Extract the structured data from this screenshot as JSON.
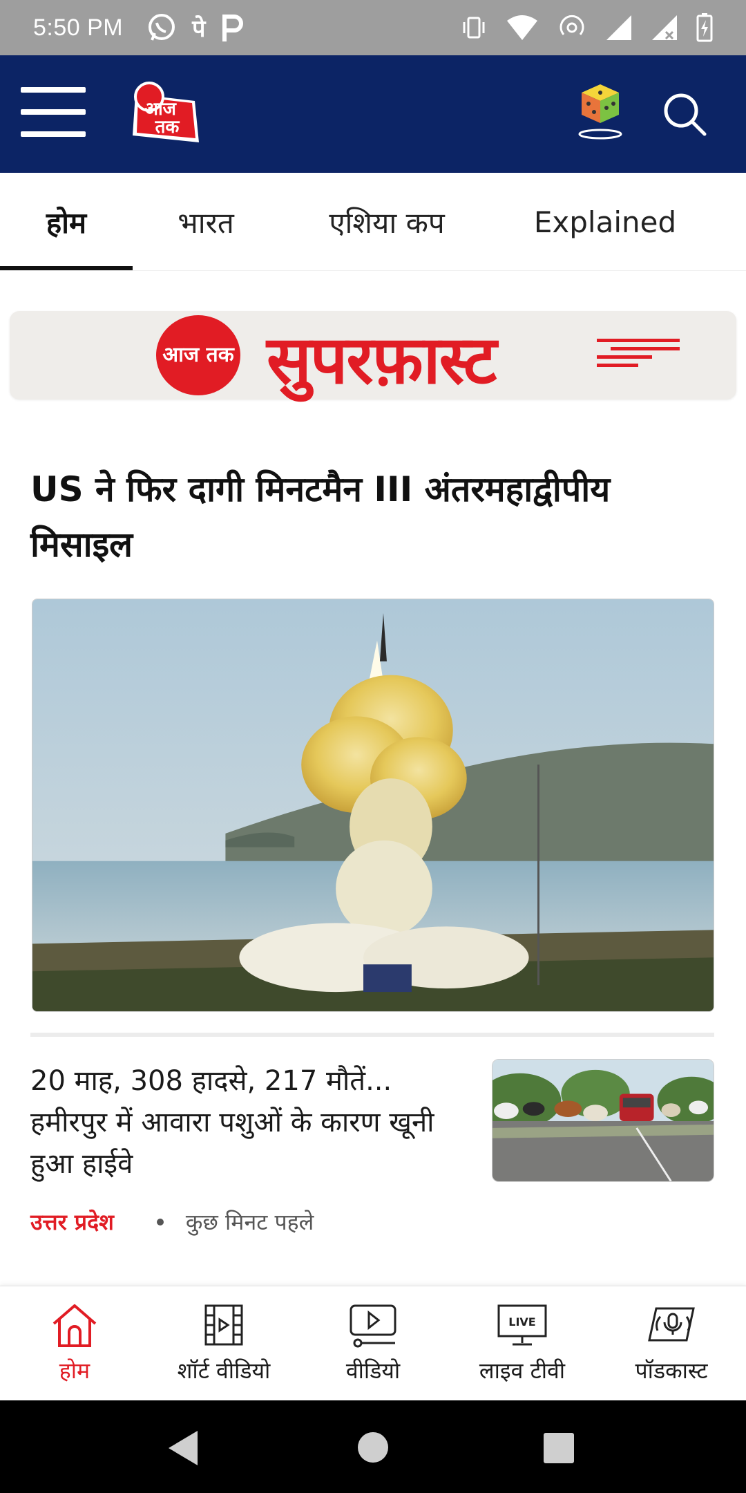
{
  "status_bar": {
    "time": "5:50 PM",
    "notification_icons": [
      "whatsapp-icon",
      "phonepe-icon",
      "paytm-icon"
    ],
    "system_icons": [
      "vibrate-icon",
      "data-arrows-icon",
      "wifi-icon",
      "hotspot-icon",
      "signal-icon",
      "signal-no-sim-icon",
      "battery-charging-icon"
    ]
  },
  "app_bar": {
    "logo_text": "आज तक",
    "background": "#0c2465",
    "icons": [
      "menu-icon",
      "dice-game-icon",
      "search-icon"
    ]
  },
  "tabs": [
    {
      "label": "होम",
      "active": true
    },
    {
      "label": "भारत",
      "active": false
    },
    {
      "label": "एशिया कप",
      "active": false
    },
    {
      "label": "Explained",
      "active": false
    }
  ],
  "banner": {
    "badge": "आज तक",
    "title": "सुपरफ़ास्ट"
  },
  "lead_story": {
    "headline": "US ने फिर दागी मिनटमैन III अंतरमहाद्वीपीय मिसाइल",
    "image": "missile-launch-photo"
  },
  "second_story": {
    "headline": "20 माह, 308 हादसे, 217 मौतें... हमीरपुर में आवारा पशुओं के कारण खूनी हुआ हाईवे",
    "category": "उत्तर प्रदेश",
    "time": "कुछ मिनट पहले",
    "image": "cattle-on-highway-photo"
  },
  "bottom_nav": [
    {
      "label": "होम",
      "icon": "home-icon",
      "active": true
    },
    {
      "label": "शॉर्ट वीडियो",
      "icon": "short-video-icon",
      "active": false
    },
    {
      "label": "वीडियो",
      "icon": "video-icon",
      "active": false
    },
    {
      "label": "लाइव टीवी",
      "icon": "live-tv-icon",
      "active": false
    },
    {
      "label": "पॉडकास्ट",
      "icon": "podcast-icon",
      "active": false
    }
  ],
  "live_badge": "LIVE",
  "colors": {
    "accent_red": "#e11c24",
    "navy": "#0c2465",
    "status_bar": "#9e9e9e"
  }
}
